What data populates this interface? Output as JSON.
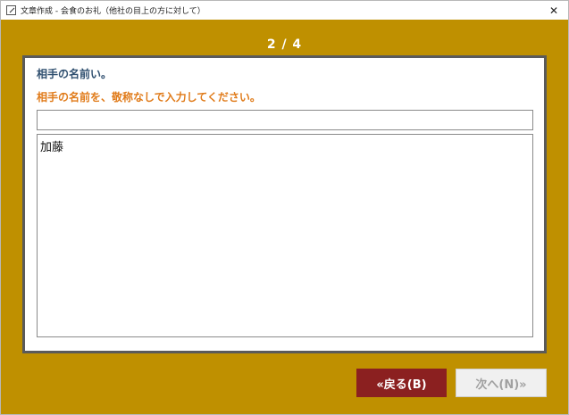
{
  "window": {
    "title": "文章作成 - 会食のお礼（他社の目上の方に対して）",
    "close_glyph": "✕"
  },
  "wizard": {
    "step": "2 / 4",
    "heading": "相手の名前い。",
    "instruction": "相手の名前を、敬称なしで入力してください。",
    "input_value": "",
    "textarea_value": "加藤"
  },
  "buttons": {
    "back_label": "«戻る(B)",
    "next_label": "次へ(N)»"
  },
  "colors": {
    "background": "#bf9000",
    "heading": "#2f4f6f",
    "instruction": "#e07b1a",
    "back_button": "#8b2020"
  }
}
